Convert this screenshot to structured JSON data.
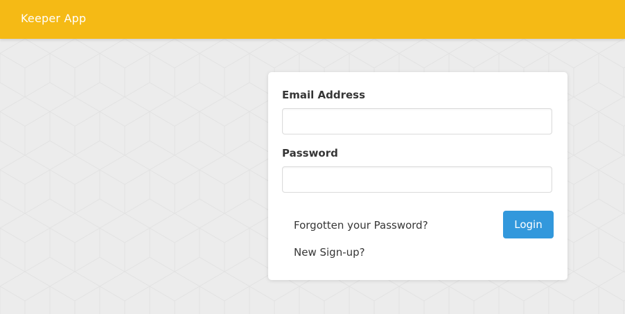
{
  "header": {
    "app_title": "Keeper App",
    "background_color": "#f5ba15"
  },
  "login_form": {
    "email_label": "Email Address",
    "email_value": "",
    "password_label": "Password",
    "password_value": "",
    "forgot_password_link": "Forgotten your Password?",
    "signup_link": "New Sign-up?",
    "login_button": "Login",
    "button_color": "#3298dc"
  }
}
